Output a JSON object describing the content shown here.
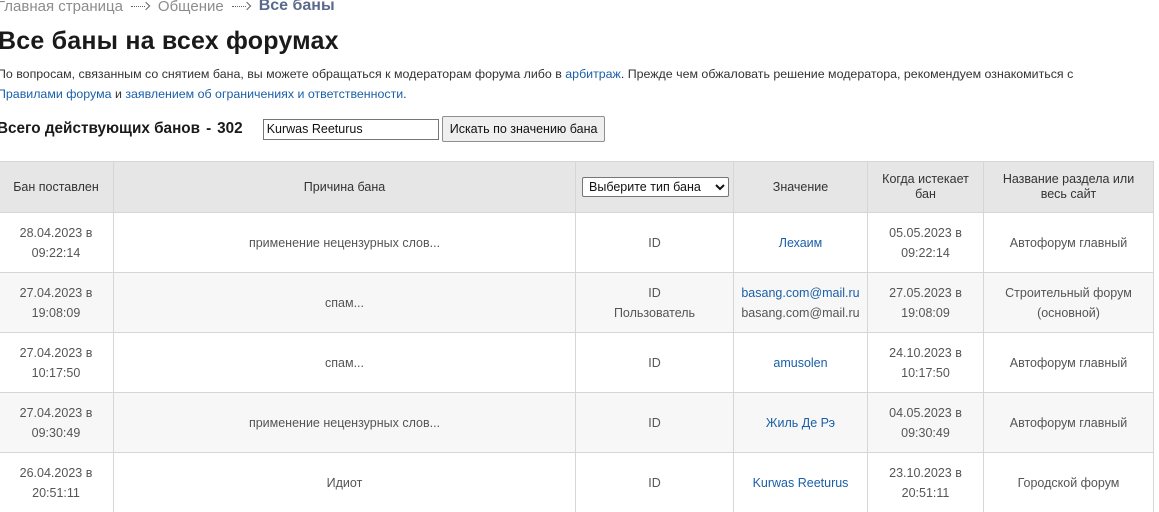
{
  "breadcrumb": {
    "items": [
      "Главная страница",
      "Общение"
    ],
    "current": "Все баны"
  },
  "page": {
    "title": "Все баны на всех форумах",
    "intro_1": "По вопросам, связанным со снятием бана, вы можете обращаться к модераторам форума либо в ",
    "intro_link_arbitration": "арбитраж",
    "intro_2": ". Прежде чем обжаловать решение модератора, рекомендуем ознакомиться с ",
    "intro_link_rules": "Правилами форума",
    "intro_3": " и ",
    "intro_link_statement": "заявлением об ограничениях и ответственности",
    "intro_4": "."
  },
  "stats": {
    "label": "Всего действующих банов",
    "separator": "-",
    "count": "302"
  },
  "search": {
    "value": "Kurwas Reeturus",
    "button_label": "Искать по значению бана"
  },
  "table": {
    "headers": {
      "date": "Бан поставлен",
      "reason": "Причина бана",
      "type_select": "Выберите тип бана",
      "value": "Значение",
      "expires": "Когда истекает бан",
      "section": "Название раздела или весь сайт"
    },
    "rows": [
      {
        "date": "28.04.2023 в 09:22:14",
        "reason": "применение нецензурных слов...",
        "type1": "ID",
        "type2": "",
        "value1": "Лехаим",
        "value2": "",
        "expires": "05.05.2023 в 09:22:14",
        "section": "Автофорум главный"
      },
      {
        "date": "27.04.2023 в 19:08:09",
        "reason": "спам...",
        "type1": "ID",
        "type2": "Пользователь",
        "value1": "basang.com@mail.ru",
        "value2": "basang.com@mail.ru",
        "expires": "27.05.2023 в 19:08:09",
        "section": "Строительный форум (основной)"
      },
      {
        "date": "27.04.2023 в 10:17:50",
        "reason": "спам...",
        "type1": "ID",
        "type2": "",
        "value1": "amusolen",
        "value2": "",
        "expires": "24.10.2023 в 10:17:50",
        "section": "Автофорум главный"
      },
      {
        "date": "27.04.2023 в 09:30:49",
        "reason": "применение нецензурных слов...",
        "type1": "ID",
        "type2": "",
        "value1": "Жиль Де Рэ",
        "value2": "",
        "expires": "04.05.2023 в 09:30:49",
        "section": "Автофорум главный"
      },
      {
        "date": "26.04.2023 в 20:51:11",
        "reason": "Идиот",
        "type1": "ID",
        "type2": "",
        "value1": "Kurwas Reeturus",
        "value2": "",
        "expires": "23.10.2023 в 20:51:11",
        "section": "Городской форум"
      }
    ]
  },
  "colors": {
    "link": "#1a5fa8",
    "header_bg": "#e6e6e6",
    "row_alt_bg": "#f7f7f7",
    "breadcrumb_current": "#5a6a8c"
  }
}
